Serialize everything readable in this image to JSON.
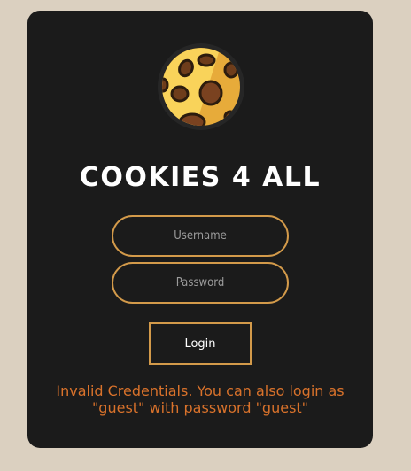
{
  "app": {
    "title": "COOKIES 4 ALL",
    "logo_icon": "cookie-icon"
  },
  "form": {
    "username": {
      "placeholder": "Username",
      "value": ""
    },
    "password": {
      "placeholder": "Password",
      "value": ""
    },
    "login_label": "Login"
  },
  "status": {
    "message": "Invalid Credentials. You can also login as \"guest\" with password \"guest\""
  },
  "colors": {
    "page_background": "#dbd0c0",
    "card_background": "#1b1b1b",
    "accent": "#d39a4a",
    "error_text": "#d9722b",
    "title_text": "#ffffff"
  }
}
